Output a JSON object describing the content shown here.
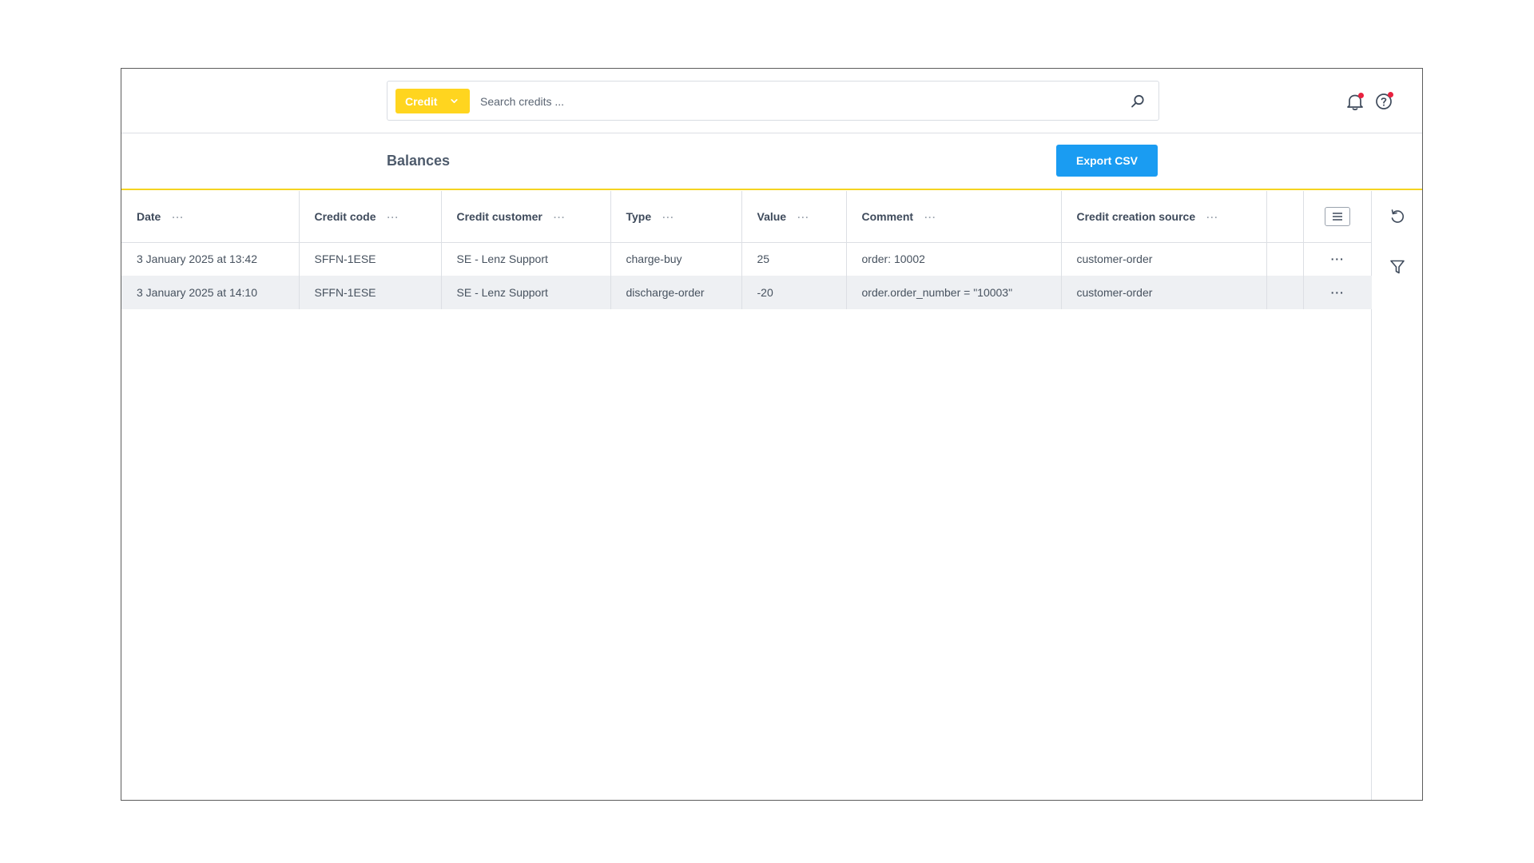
{
  "search": {
    "category_label": "Credit",
    "placeholder": "Search credits ...",
    "value": ""
  },
  "header": {
    "title": "Balances",
    "export_label": "Export CSV"
  },
  "table": {
    "columns": [
      "Date",
      "Credit code",
      "Credit customer",
      "Type",
      "Value",
      "Comment",
      "Credit creation source"
    ],
    "column_menu_glyph": "···",
    "row_menu_glyph": "···",
    "rows": [
      [
        "3 January 2025 at 13:42",
        "SFFN-1ESE",
        "SE - Lenz Support",
        "charge-buy",
        "25",
        "order: 10002",
        "customer-order"
      ],
      [
        "3 January 2025 at 14:10",
        "SFFN-1ESE",
        "SE - Lenz Support",
        "discharge-order",
        "-20",
        "order.order_number = \"10003\"",
        "customer-order"
      ]
    ]
  },
  "colors": {
    "accent_yellow": "#ffd51f",
    "primary_blue": "#1a9cf2",
    "notification_red": "#e8213e"
  },
  "icons": {
    "category_dropdown": "chevron-down-icon",
    "search": "search-icon",
    "notifications": "bell-icon",
    "help": "help-icon",
    "column_settings": "menu-icon",
    "reset": "reset-icon",
    "filter": "filter-icon"
  }
}
